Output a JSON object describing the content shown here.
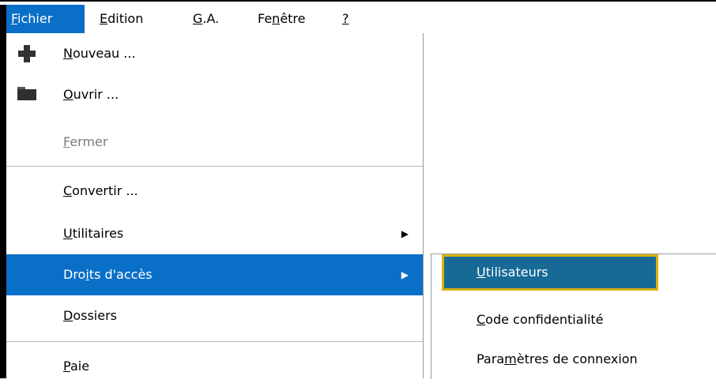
{
  "menubar": {
    "items": [
      {
        "pre": "",
        "u": "F",
        "post": "ichier"
      },
      {
        "pre": "",
        "u": "E",
        "post": "dition"
      },
      {
        "pre": "",
        "u": "G",
        "post": ".A."
      },
      {
        "pre": "Fe",
        "u": "n",
        "post": "être"
      },
      {
        "pre": "",
        "u": "?",
        "post": ""
      }
    ]
  },
  "fichier_menu": {
    "items": [
      {
        "pre": "",
        "u": "N",
        "post": "ouveau ...",
        "icon": "plus-icon",
        "disabled": false
      },
      {
        "pre": "",
        "u": "O",
        "post": "uvrir ...",
        "icon": "folder-open-icon",
        "disabled": false
      },
      {
        "pre": "",
        "u": "F",
        "post": "ermer",
        "disabled": true
      },
      {
        "pre": "",
        "u": "C",
        "post": "onvertir ...",
        "disabled": false
      },
      {
        "pre": "",
        "u": "U",
        "post": "tilitaires",
        "submenu": true,
        "disabled": false
      },
      {
        "pre": "Dro",
        "u": "i",
        "post": "ts d'accès",
        "submenu": true,
        "highlighted": true,
        "disabled": false
      },
      {
        "pre": "",
        "u": "D",
        "post": "ossiers",
        "disabled": false
      },
      {
        "pre": "",
        "u": "P",
        "post": "aie",
        "disabled": false
      }
    ],
    "arrow_glyph": "▶"
  },
  "droits_submenu": {
    "items": [
      {
        "pre": "",
        "u": "U",
        "post": "tilisateurs",
        "highlighted": true
      },
      {
        "pre": "",
        "u": "C",
        "post": "ode confidentialité"
      },
      {
        "pre": "Para",
        "u": "m",
        "post": "ètres de connexion"
      }
    ]
  },
  "colors": {
    "highlight": "#0a6fc7",
    "submenu_highlight": "#176a95",
    "focus_outline": "#d7b40b"
  }
}
